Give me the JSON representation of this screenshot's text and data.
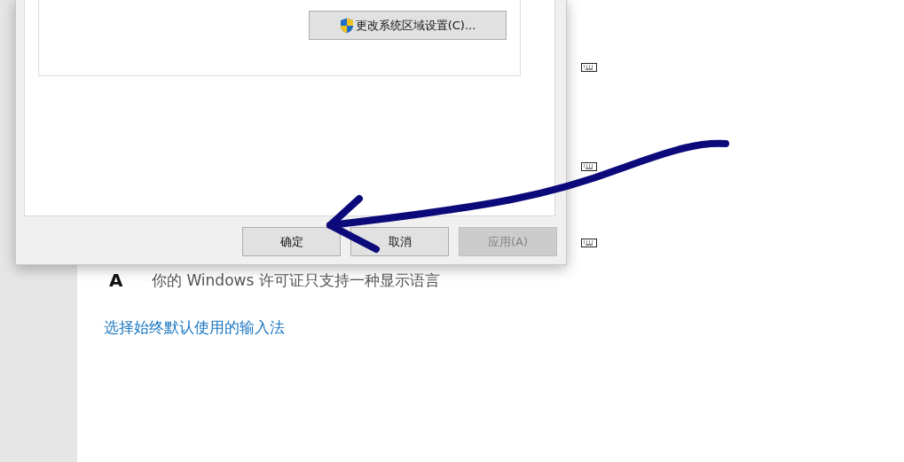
{
  "dialog": {
    "region_button": {
      "label": "更改系统区域设置(C)..."
    },
    "buttons": [
      {
        "label": "确定",
        "disabled": false
      },
      {
        "label": "取消",
        "disabled": false
      },
      {
        "label": "应用(A)",
        "disabled": true
      }
    ]
  },
  "settings": {
    "language_note": {
      "icon_glyph": "A",
      "text": "你的 Windows 许可证只支持一种显示语言"
    },
    "link": "选择始终默认使用的输入法"
  }
}
